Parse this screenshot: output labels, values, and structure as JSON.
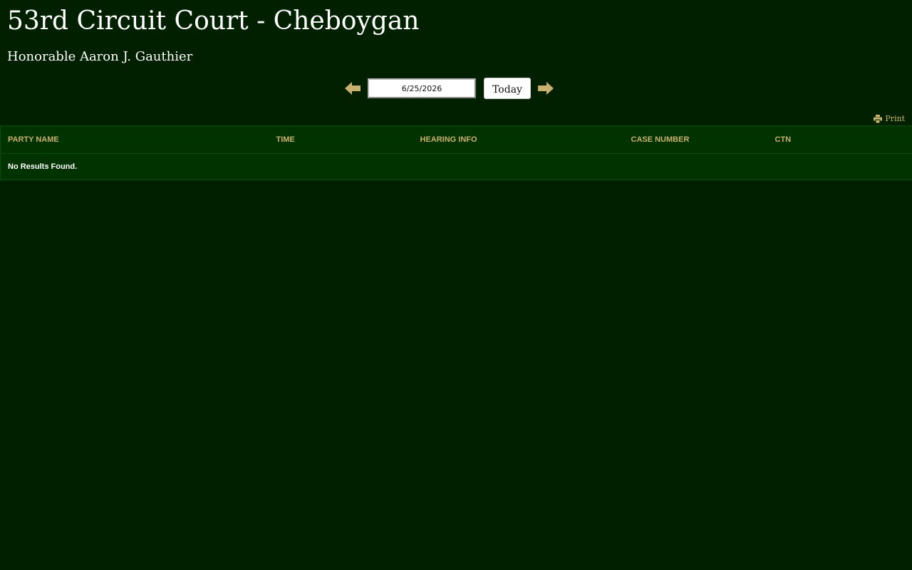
{
  "header": {
    "title": "53rd Circuit Court - Cheboygan",
    "judge": "Honorable Aaron J. Gauthier"
  },
  "date_nav": {
    "prev_icon": "arrow-left-icon",
    "next_icon": "arrow-right-icon",
    "date_value": "6/25/2026",
    "today_label": "Today"
  },
  "print": {
    "icon": "printer-icon",
    "label": "Print"
  },
  "table": {
    "columns": [
      "PARTY NAME",
      "TIME",
      "HEARING INFO",
      "CASE NUMBER",
      "CTN"
    ],
    "empty_message": "No Results Found."
  },
  "colors": {
    "background": "#002000",
    "table_bg": "#003300",
    "accent_gold": "#c8b070",
    "text": "#ffffff"
  }
}
